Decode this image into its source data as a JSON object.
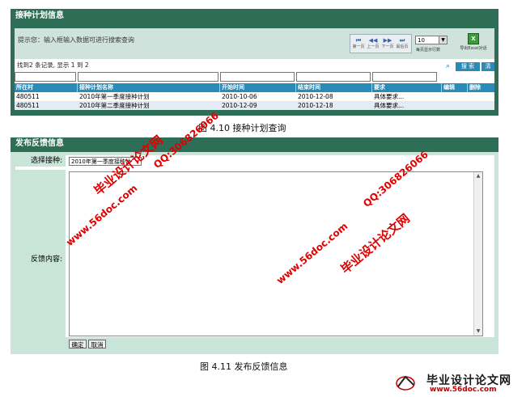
{
  "panel1": {
    "title": "接种计划信息",
    "hint": "提示您：输入框输入数据可进行搜索查询",
    "pager": {
      "buttons": [
        {
          "glyph": "⏮",
          "label": "第一页"
        },
        {
          "glyph": "◀◀",
          "label": "上一页"
        },
        {
          "glyph": "▶▶",
          "label": "下一页"
        },
        {
          "glyph": "⏭",
          "label": "最后页"
        }
      ],
      "rows_value": "10",
      "rows_label": "每页显示行数",
      "export_label": "导出Excel对话"
    },
    "found_text": "找到2 条记录, 显示 1 到 2",
    "search_label": "搜 索",
    "clear_label": "清 除",
    "columns": [
      "所在村",
      "接种计划名称",
      "开始时间",
      "结束时间",
      "要求",
      "编辑",
      "删除"
    ],
    "rows": [
      [
        "480511",
        "2010年第一季度接种计划",
        "2010-10-06",
        "2010-12-08",
        "具体要求..."
      ],
      [
        "480511",
        "2010年第二季度接种计划",
        "2010-12-09",
        "2010-12-18",
        "具体要求..."
      ]
    ]
  },
  "caption1": "图 4.10  接种计划查询",
  "panel2": {
    "title": "发布反馈信息",
    "type_label": "选择接种:",
    "type_value": "2010年第一季度接种计",
    "content_label": "反馈内容:",
    "confirm_label": "确定",
    "cancel_label": "取消"
  },
  "caption2": "图 4.11  发布反馈信息",
  "watermarks": {
    "site_cn": "毕业设计论文网",
    "site_url": "www.56doc.com",
    "qq": "QQ:306826066"
  },
  "footer": {
    "name": "毕业设计论文网",
    "url": "www.56doc.com"
  },
  "colors": {
    "title_bar": "#2f6e56",
    "table_header": "#2a8bb8",
    "panel_bg": "#c9e4d9",
    "watermark": "#e00000"
  }
}
